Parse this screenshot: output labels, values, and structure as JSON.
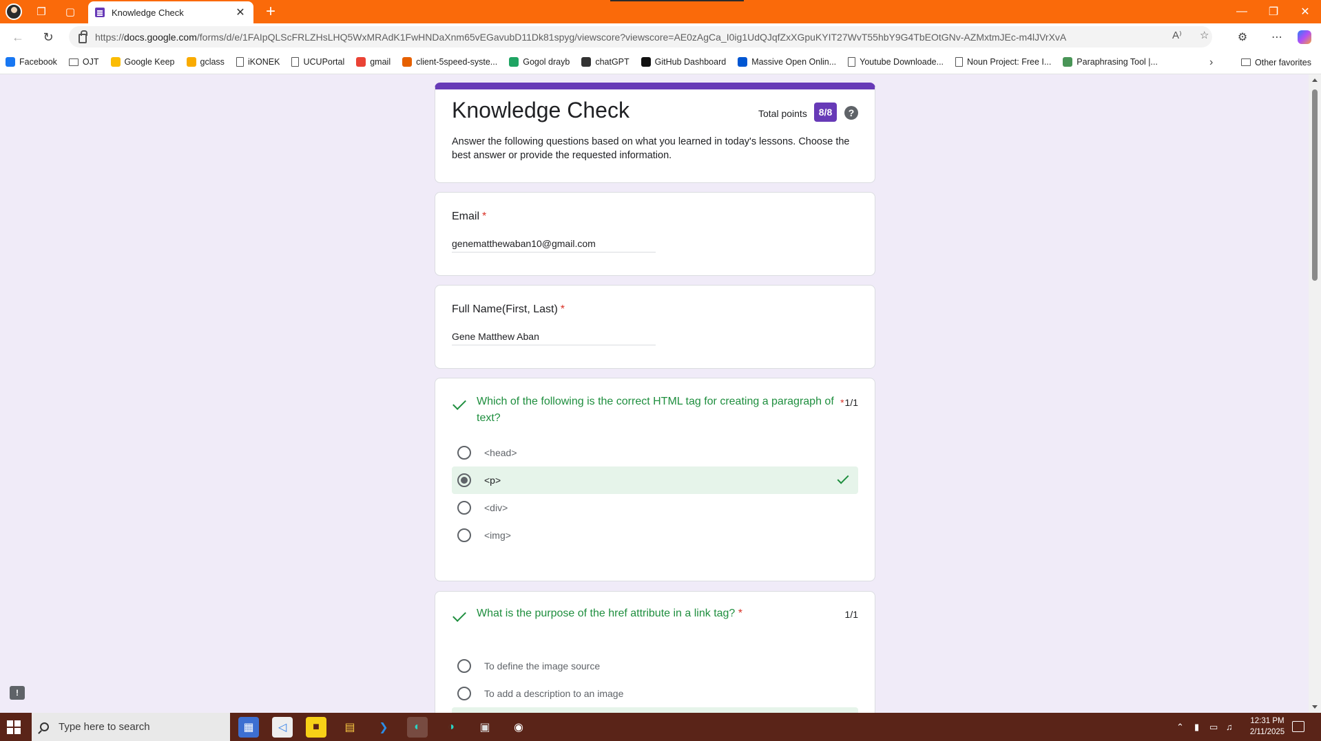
{
  "browser": {
    "tab_title": "Knowledge Check",
    "url_prefix": "https://",
    "url_host": "docs.google.com",
    "url_path": "/forms/d/e/1FAIpQLScFRLZHsLHQ5WxMRAdK1FwHNDaXnm65vEGavubD11Dk81spyg/viewscore?viewscore=AE0zAgCa_I0ig1UdQJqfZxXGpuKYIT27WvT55hbY9G4TbEOtGNv-AZMxtmJEc-m4lJVrXvA",
    "bookmarks": [
      {
        "label": "Facebook",
        "icon": "facebook-icon",
        "color": "#1877f2"
      },
      {
        "label": "OJT",
        "icon": "folder-icon",
        "color": ""
      },
      {
        "label": "Google Keep",
        "icon": "keep-icon",
        "color": "#fbbc04"
      },
      {
        "label": "gclass",
        "icon": "classroom-icon",
        "color": "#f9ab00"
      },
      {
        "label": "iKONEK",
        "icon": "page-icon",
        "color": ""
      },
      {
        "label": "UCUPortal",
        "icon": "page-icon",
        "color": ""
      },
      {
        "label": "gmail",
        "icon": "gmail-icon",
        "color": "#ea4335"
      },
      {
        "label": "client-5speed-syste...",
        "icon": "firefox-icon",
        "color": "#e66000"
      },
      {
        "label": "Gogol drayb",
        "icon": "drive-icon",
        "color": "#1fa463"
      },
      {
        "label": "chatGPT",
        "icon": "chatgpt-icon",
        "color": "#333333"
      },
      {
        "label": "GitHub Dashboard",
        "icon": "github-icon",
        "color": "#111111"
      },
      {
        "label": "Massive Open Onlin...",
        "icon": "coursera-icon",
        "color": "#0056d2"
      },
      {
        "label": "Youtube Downloade...",
        "icon": "page-icon",
        "color": ""
      },
      {
        "label": "Noun Project: Free I...",
        "icon": "page-icon",
        "color": ""
      },
      {
        "label": "Paraphrasing Tool |...",
        "icon": "quillbot-icon",
        "color": "#499557"
      }
    ],
    "other_favorites": "Other favorites"
  },
  "form": {
    "title": "Knowledge Check",
    "total_points_label": "Total points",
    "total_points": "8/8",
    "description": "Answer the following questions based on what you learned in today's lessons. Choose the best answer or provide the requested information.",
    "accent_color": "#673ab7",
    "fields": [
      {
        "label": "Email",
        "required_mark": "*",
        "value": "genematthewaban10@gmail.com"
      },
      {
        "label": "Full Name(First, Last)",
        "required_mark": "*",
        "value": "Gene Matthew Aban"
      }
    ],
    "questions": [
      {
        "text": "Which of the following is the correct HTML tag for creating a paragraph of text?",
        "required_mark": "*",
        "score": "1/1",
        "options": [
          "<head>",
          "<p>",
          "<div>",
          "<img>"
        ],
        "selected_index": 1
      },
      {
        "text": "What is the purpose of the href attribute in a link tag?",
        "required_mark": "*",
        "score": "1/1",
        "options": [
          "To define the image source",
          "To add a description to an image"
        ]
      }
    ]
  },
  "taskbar": {
    "search_placeholder": "Type here to search",
    "time": "12:31 PM",
    "date": "2/11/2025"
  }
}
